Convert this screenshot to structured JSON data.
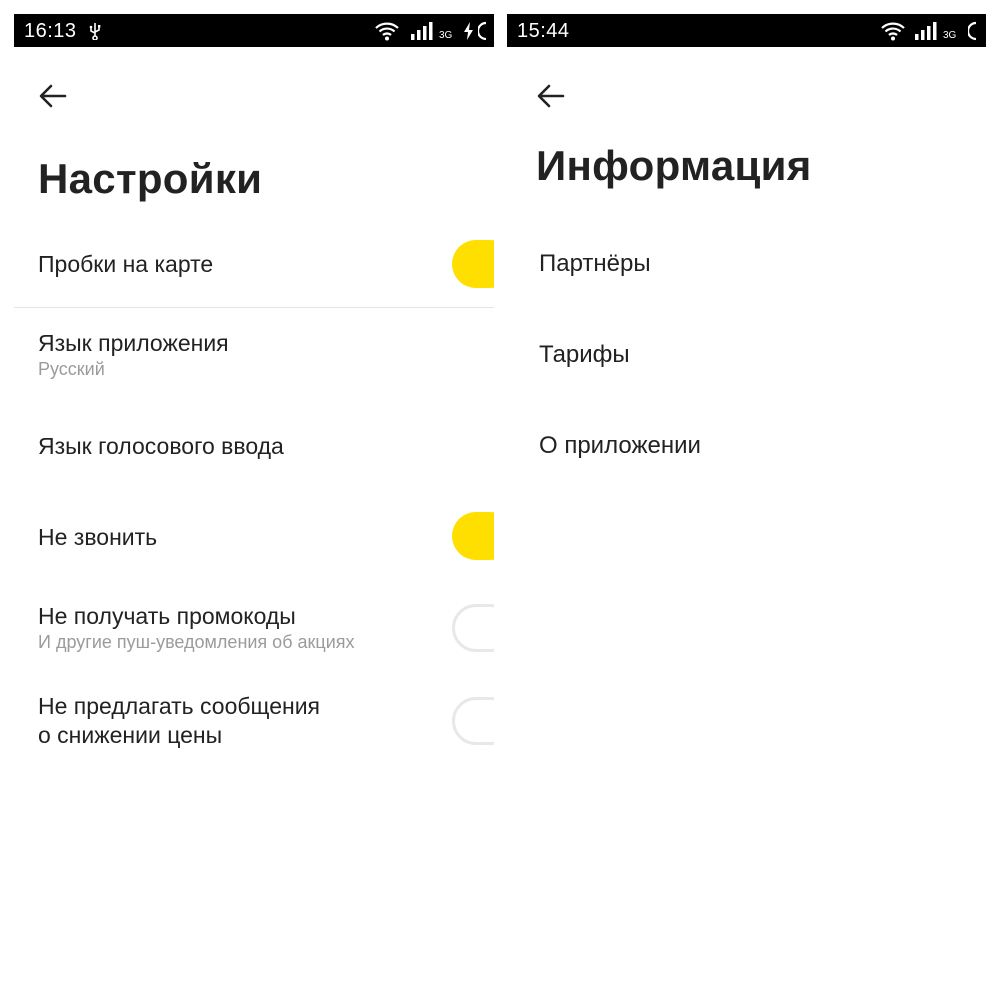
{
  "left_screen": {
    "status_bar": {
      "time": "16:13",
      "network_type": "3G"
    },
    "title": "Настройки",
    "settings": [
      {
        "label": "Пробки на карте",
        "toggle": "on"
      },
      {
        "label": "Язык приложения",
        "subtitle": "Русский"
      },
      {
        "label": "Язык голосового ввода"
      },
      {
        "label": "Не звонить",
        "toggle": "on"
      },
      {
        "label": "Не получать промокоды",
        "subtitle": "И другие пуш-уведомления об акциях",
        "toggle": "off"
      },
      {
        "label_line1": "Не предлагать сообщения",
        "label_line2": "о снижении цены",
        "toggle": "off"
      }
    ]
  },
  "right_screen": {
    "status_bar": {
      "time": "15:44",
      "network_type": "3G"
    },
    "title": "Информация",
    "items": [
      {
        "label": "Партнёры"
      },
      {
        "label": "Тарифы"
      },
      {
        "label": "О приложении"
      }
    ]
  },
  "colors": {
    "accent": "#ffdf00",
    "status_bar": "#000000",
    "subtitle": "#9b9b9b"
  }
}
